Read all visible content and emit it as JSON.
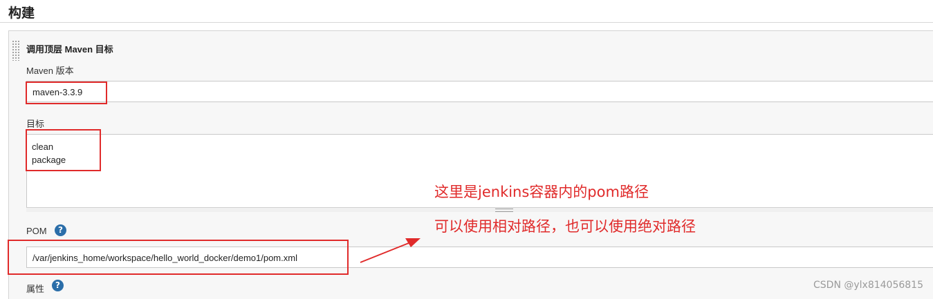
{
  "section": {
    "title": "构建"
  },
  "step": {
    "title": "调用顶层 Maven 目标",
    "maven_version": {
      "label": "Maven 版本",
      "value": "maven-3.3.9"
    },
    "goals": {
      "label": "目标",
      "lines": [
        "clean",
        "package"
      ]
    },
    "pom": {
      "label": "POM",
      "help_icon": "question-icon",
      "value": "/var/jenkins_home/workspace/hello_world_docker/demo1/pom.xml"
    },
    "properties": {
      "label": "属性",
      "help_icon": "question-icon"
    }
  },
  "annotations": {
    "line1": "这里是jenkins容器内的pom路径",
    "line2": "可以使用相对路径，也可以使用绝对路径",
    "color": "#e02a2a"
  },
  "watermark": "CSDN @ylx814056815",
  "colors": {
    "help_icon": "#2b6ea9",
    "panel_bg": "#f7f7f7"
  }
}
